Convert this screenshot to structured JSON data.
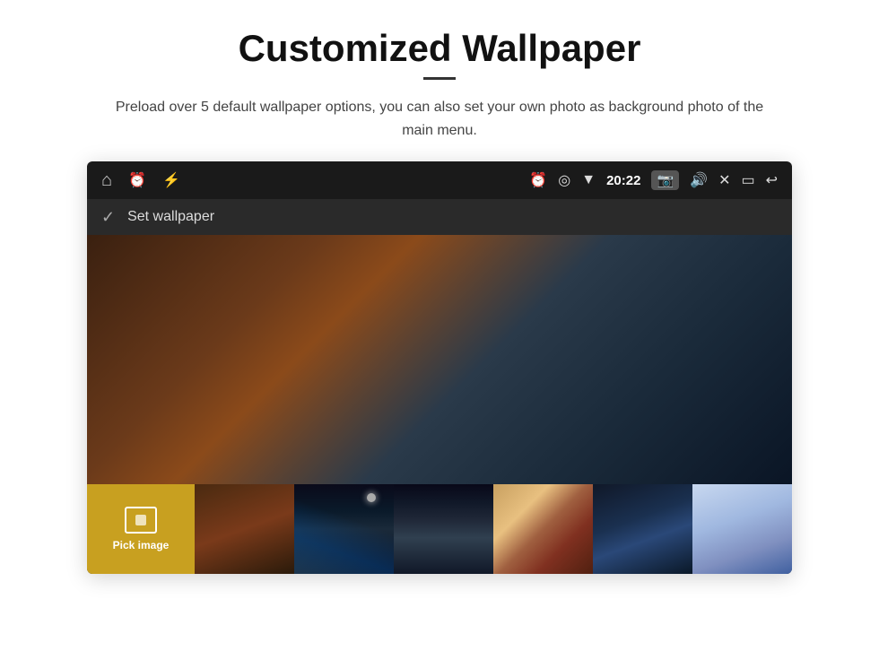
{
  "header": {
    "title": "Customized Wallpaper",
    "subtitle": "Preload over 5 default wallpaper options, you can also set your own photo as background photo of the main menu."
  },
  "statusBar": {
    "time": "20:22",
    "icons": [
      "home",
      "alarm",
      "usb",
      "alarm2",
      "location",
      "wifi",
      "camera",
      "volume",
      "close",
      "window",
      "back"
    ]
  },
  "toolbar": {
    "label": "Set wallpaper"
  },
  "thumbnails": {
    "pickLabel": "Pick image",
    "items": [
      "thumb1",
      "thumb2",
      "thumb3",
      "thumb4",
      "thumb5",
      "thumb6"
    ]
  }
}
